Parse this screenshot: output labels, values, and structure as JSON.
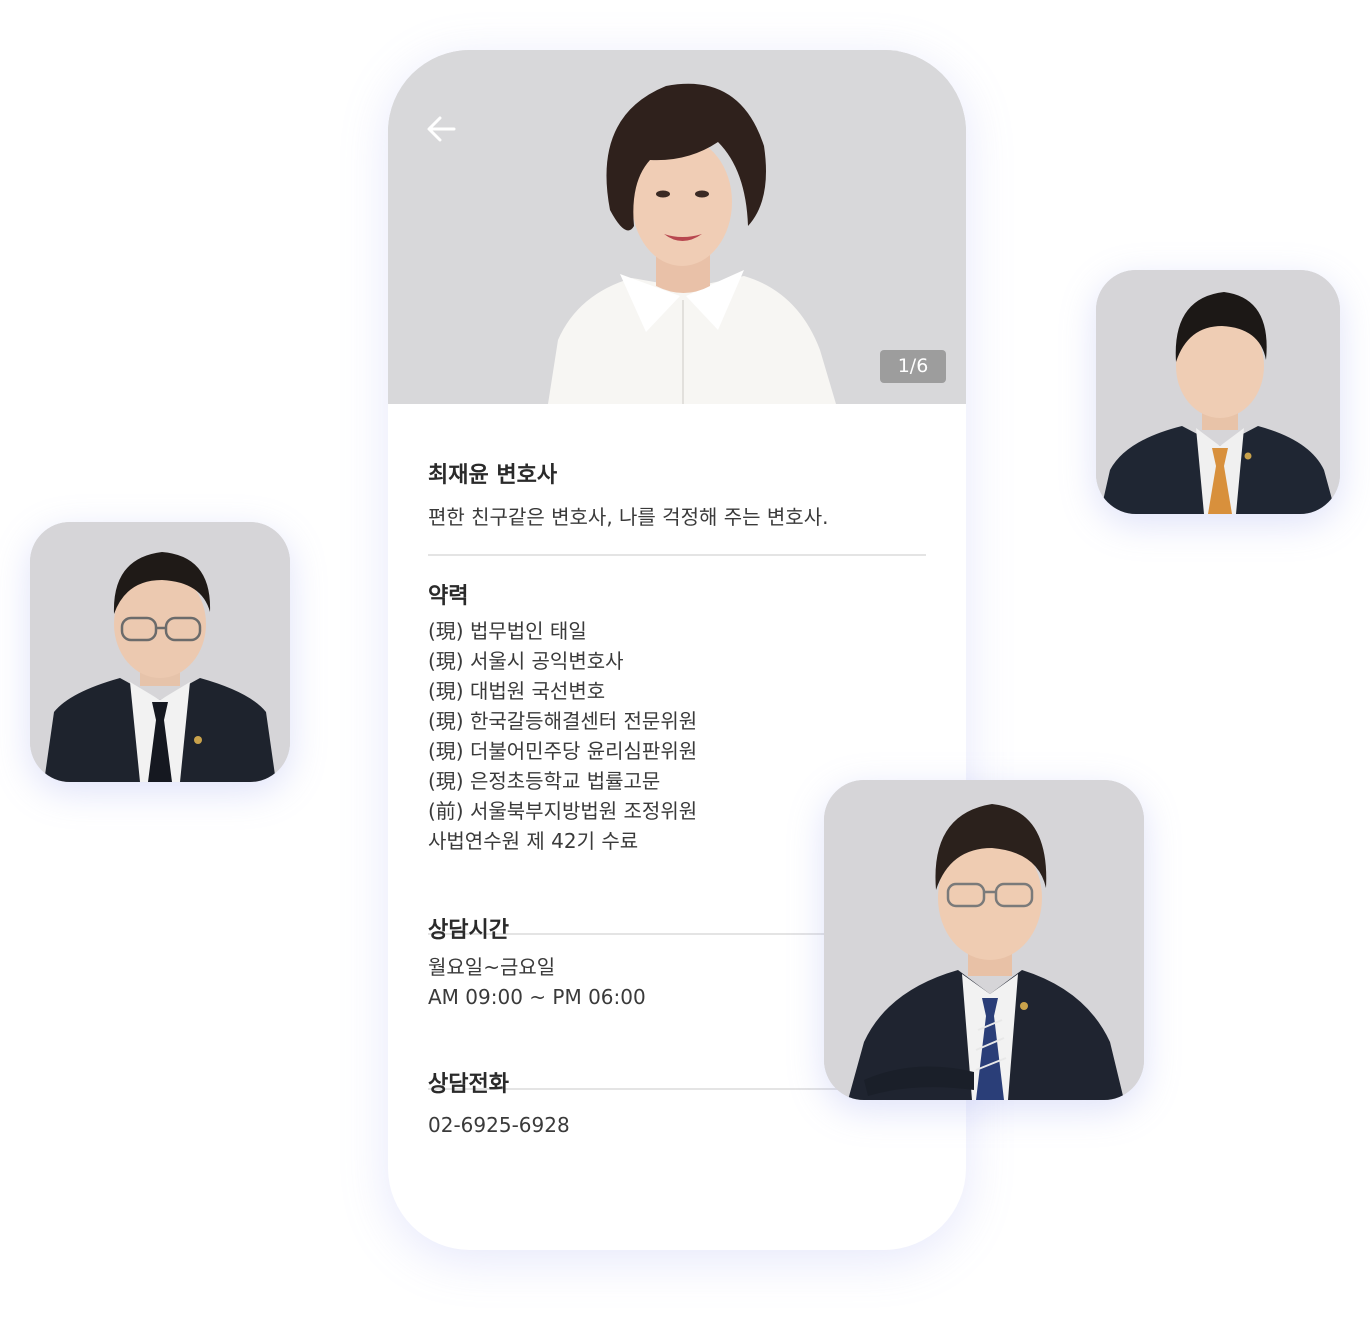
{
  "profile": {
    "photo_counter": "1/6",
    "name": "최재윤 변호사",
    "tagline": "편한 친구같은 변호사, 나를 걱정해 주는 변호사."
  },
  "career": {
    "title": "약력",
    "items": [
      "(現) 법무법인 태일",
      "(現) 서울시 공익변호사",
      "(現) 대법원 국선변호",
      "(現) 한국갈등해결센터 전문위원",
      "(現) 더불어민주당 윤리심판위원",
      "(現) 은정초등학교 법률고문",
      "(前) 서울북부지방법원 조정위원",
      "사법연수원 제 42기 수료"
    ]
  },
  "hours": {
    "title": "상담시간",
    "lines": [
      "월요일~금요일",
      "AM 09:00 ~ PM 06:00"
    ]
  },
  "phone": {
    "title": "상담전화",
    "number": "02-6925-6928"
  },
  "icons": {
    "back": "arrow-left-icon"
  },
  "colors": {
    "page_bg": "#ffffff",
    "photo_bg": "#d6d5d8",
    "text_dark": "#2a2a2a",
    "divider": "#e4e4e4",
    "glow": "#8c96eb"
  }
}
